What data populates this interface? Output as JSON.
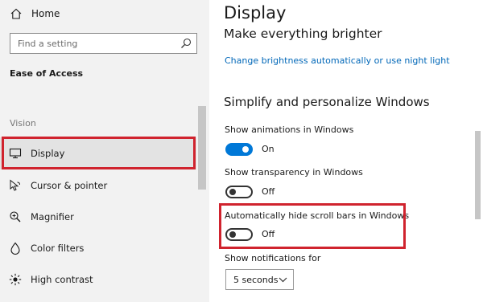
{
  "sidebar": {
    "home_label": "Home",
    "search_placeholder": "Find a setting",
    "section_title": "Ease of Access",
    "group_label": "Vision",
    "items": [
      {
        "label": "Display",
        "icon": "monitor-icon"
      },
      {
        "label": "Cursor & pointer",
        "icon": "cursor-icon"
      },
      {
        "label": "Magnifier",
        "icon": "magnifier-icon"
      },
      {
        "label": "Color filters",
        "icon": "color-filter-icon"
      },
      {
        "label": "High contrast",
        "icon": "high-contrast-icon"
      }
    ]
  },
  "main": {
    "title": "Display",
    "subtitle": "Make everything brighter",
    "link": "Change brightness automatically or use night light",
    "section_heading": "Simplify and personalize Windows",
    "settings": [
      {
        "label": "Show animations in Windows",
        "state": "On",
        "on": true
      },
      {
        "label": "Show transparency in Windows",
        "state": "Off",
        "on": false
      },
      {
        "label": "Automatically hide scroll bars in Windows",
        "state": "Off",
        "on": false
      }
    ],
    "notifications": {
      "label": "Show notifications for",
      "value": "5 seconds"
    }
  },
  "colors": {
    "accent": "#0078d7",
    "link": "#0067b8",
    "highlight": "#d0232e",
    "sidebar_bg": "#f2f2f2"
  }
}
